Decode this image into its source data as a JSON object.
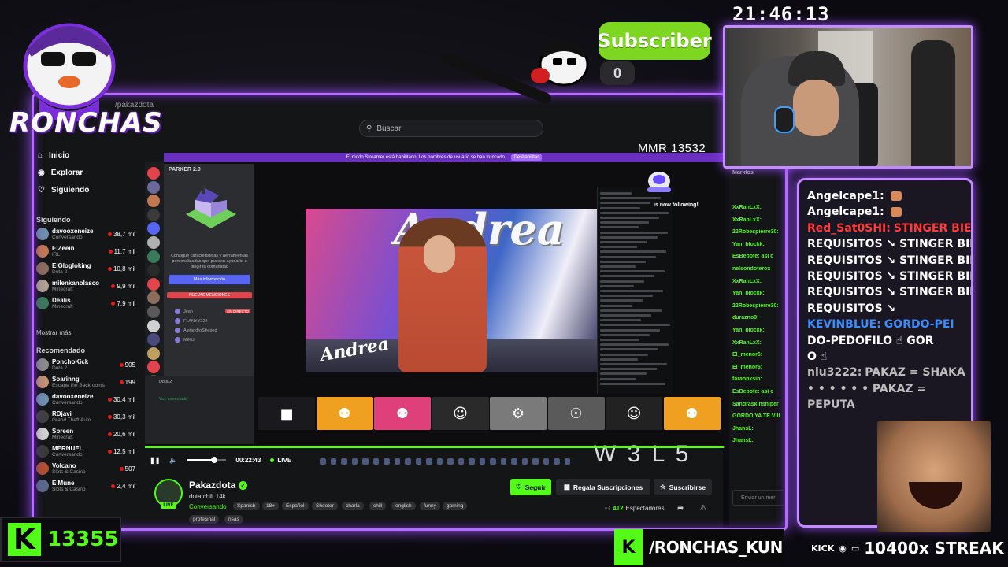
{
  "overlay": {
    "clock": "21:46:13",
    "logo_text": "RONCHAS",
    "subscriber_label": "Subscriber",
    "subscriber_count": "0",
    "kick_followers": "13355",
    "handle": "/RONCHAS_KUN",
    "streak_prefix": "KICK",
    "streak_text": "10400x STREAK",
    "colors": {
      "neon": "#b66cff",
      "kick_green": "#53fc18",
      "sub_green": "#7dd61f"
    }
  },
  "overlay_chat": [
    {
      "user": "Angelcape1:",
      "text": "",
      "user_color": "#ffffff",
      "emote": true
    },
    {
      "user": "Angelcape1:",
      "text": "",
      "user_color": "#ffffff",
      "emote": true
    },
    {
      "user": "Red_Sat0SHI:",
      "text": "STINGER BIENV",
      "user_color": "#ff3b3b"
    },
    {
      "user": "",
      "text": "REQUISITOS ↘ STINGER BIE",
      "user_color": "#ffffff"
    },
    {
      "user": "",
      "text": "REQUISITOS ↘ STINGER BIE",
      "user_color": "#ffffff"
    },
    {
      "user": "",
      "text": "REQUISITOS ↘ STINGER BIE",
      "user_color": "#ffffff"
    },
    {
      "user": "",
      "text": "REQUISITOS ↘ STINGER BIE",
      "user_color": "#ffffff"
    },
    {
      "user": "",
      "text": "REQUISITOS ↘",
      "user_color": "#ffffff"
    },
    {
      "user": "KEVINBLUE:",
      "text": "GORDO-PEI",
      "user_color": "#3b8dff"
    },
    {
      "user": "",
      "text": "DO-PEDOFILO ☝ GOR",
      "user_color": "#ffffff"
    },
    {
      "user": "",
      "text": "O ☝",
      "user_color": "#ffffff"
    },
    {
      "user": "niu3222:",
      "text": "PAKAZ = SHAKA",
      "user_color": "#bdbdbd"
    },
    {
      "user": "",
      "text": "• • • • • • PAKAZ =",
      "user_color": "#bdbdbd"
    },
    {
      "user": "",
      "text": "PEPUTA",
      "user_color": "#bdbdbd"
    }
  ],
  "site": {
    "url": "/pakazdota",
    "search_placeholder": "Buscar",
    "nav": [
      {
        "label": "Inicio",
        "icon": "home-icon"
      },
      {
        "label": "Explorar",
        "icon": "compass-icon"
      },
      {
        "label": "Siguiendo",
        "icon": "heart-icon"
      }
    ],
    "following_header": "Siguiendo",
    "following": [
      {
        "name": "davooxeneize",
        "sub": "Conversando",
        "count": "38,7 mil",
        "color": "#6d8fae"
      },
      {
        "name": "ElZeein",
        "sub": "IRL",
        "count": "11,7 mil",
        "color": "#c07850"
      },
      {
        "name": "ElGlogloking",
        "sub": "Dota 2",
        "count": "10,8 mil",
        "color": "#8a6d5a"
      },
      {
        "name": "milenkanolasco",
        "sub": "Minecraft",
        "count": "9,9 mil",
        "color": "#b0a090"
      },
      {
        "name": "Dealis",
        "sub": "Minecraft",
        "count": "7,9 mil",
        "color": "#3a7a5a"
      }
    ],
    "show_more": "Mostrar más",
    "recommended_header": "Recomendado",
    "recommended": [
      {
        "name": "PonchoKick",
        "sub": "Dota 2",
        "count": "905",
        "color": "#8a8a8a"
      },
      {
        "name": "Soarinng",
        "sub": "Escape the Backrooms",
        "count": "199",
        "color": "#c09070"
      },
      {
        "name": "davooxeneize",
        "sub": "Conversando",
        "count": "30,4 mil",
        "color": "#6d8fae"
      },
      {
        "name": "RDjavi",
        "sub": "Grand Theft Auto...",
        "count": "30,3 mil",
        "color": "#404040"
      },
      {
        "name": "Spreen",
        "sub": "Minecraft",
        "count": "20,6 mil",
        "color": "#d0d0d0"
      },
      {
        "name": "MERNUEL",
        "sub": "Conversando",
        "count": "12,5 mil",
        "color": "#3a3a3a"
      },
      {
        "name": "Volcano",
        "sub": "Slots & Casino",
        "count": "507",
        "color": "#b05030"
      },
      {
        "name": "ElMune",
        "sub": "Slots & Casino",
        "count": "2,4 mil",
        "color": "#5a6a8a"
      }
    ],
    "player": {
      "streamer_banner": "El modo Streamer está habilitado. Los nombres de usuario se han truncado.",
      "banner_button": "Deshabilitar",
      "discord_title": "PARKER 2.0",
      "discord_text": "Consigue características y herramientas personalizadas que pueden ayudarte a dirigir tu comunidad",
      "discord_button": "Más información",
      "discord_red": "NUEVAS MENCIONES",
      "voice": [
        {
          "name": "Jean",
          "live": "EN DIRECTO"
        },
        {
          "name": "FLANYY222",
          "live": ""
        },
        {
          "name": "AlejandroStreped",
          "live": ""
        },
        {
          "name": "MIKU",
          "live": ""
        }
      ],
      "discord_game": "Dota 2",
      "discord_status": "Voz conectada",
      "video_logo": "Andrea",
      "video_sign": "Andrea",
      "mmr": "MMR 13532",
      "follow_note": "is now following!",
      "wl": "W 3  L 5",
      "time": "00:22:43",
      "live": "LIVE",
      "progress": 0.998,
      "volume": 0.7
    },
    "channel": {
      "name": "Pakazdota",
      "title": "dota chill 14k",
      "category": "Conversando",
      "live_badge": "LIVE",
      "tags": [
        "Spanish",
        "18+",
        "Español",
        "Shooter",
        "charla",
        "chill",
        "english",
        "funny",
        "gaming",
        "profesinal",
        "risas"
      ],
      "follow": "Seguir",
      "gift": "Regala Suscripciones",
      "subscribe": "Suscribirse",
      "viewers_count": "412",
      "viewers_label": "Espectadores"
    },
    "chat": {
      "top_user": "Marktos",
      "users": [
        "XxRanLxX:",
        "XxRanLxX:",
        "22Robespierre30:",
        "Yan_blockk:",
        "EsBebote: así c",
        "nelsondoterox",
        "XxRanLxX:",
        "Yan_blockk:",
        "22Robespierre30:",
        "durazno9:",
        "Yan_blockk:",
        "XxRanLxX:",
        "El_menor6:",
        "El_menor6:",
        "faraonxsin:",
        "EsBebote: así c",
        "Sandraskinsniper",
        "GORDO YA TE VIII",
        "JhansL:",
        "JhansL:"
      ],
      "input_placeholder": "Enviar un mer"
    }
  }
}
